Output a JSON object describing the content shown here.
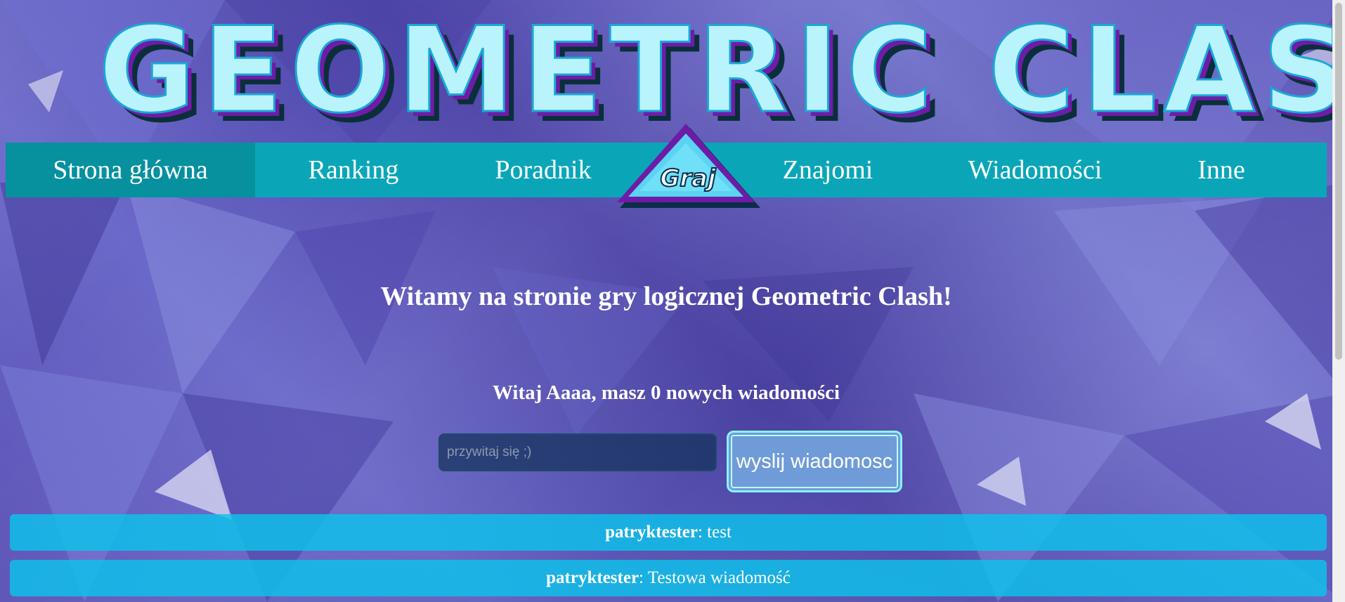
{
  "logo": {
    "text": "GEOMETRIC CLASH"
  },
  "nav": {
    "items": [
      {
        "label": "Strona główna",
        "active": true
      },
      {
        "label": "Ranking"
      },
      {
        "label": "Poradnik"
      },
      {
        "label": "Znajomi"
      },
      {
        "label": "Wiadomości"
      },
      {
        "label": "Inne"
      }
    ],
    "play": {
      "label": "Graj",
      "icon": "triangle-icon"
    }
  },
  "main": {
    "welcome": "Witamy na stronie gry logicznej Geometric Clash!",
    "greeting": "Witaj Aaaa, masz 0 nowych wiadomości"
  },
  "form": {
    "input_placeholder": "przywitaj się ;)",
    "input_value": "",
    "send_label": "wyslij wiadomosc"
  },
  "messages": [
    {
      "author": "patryktester",
      "text": ": test"
    },
    {
      "author": "patryktester",
      "text": ": Testowa wiadomość"
    }
  ],
  "colors": {
    "nav": "#0aa6b8",
    "nav_active": "#07909e",
    "message_bg": "#0cc3eb",
    "button": "#6f9cd8",
    "background": "#5b52b6"
  }
}
